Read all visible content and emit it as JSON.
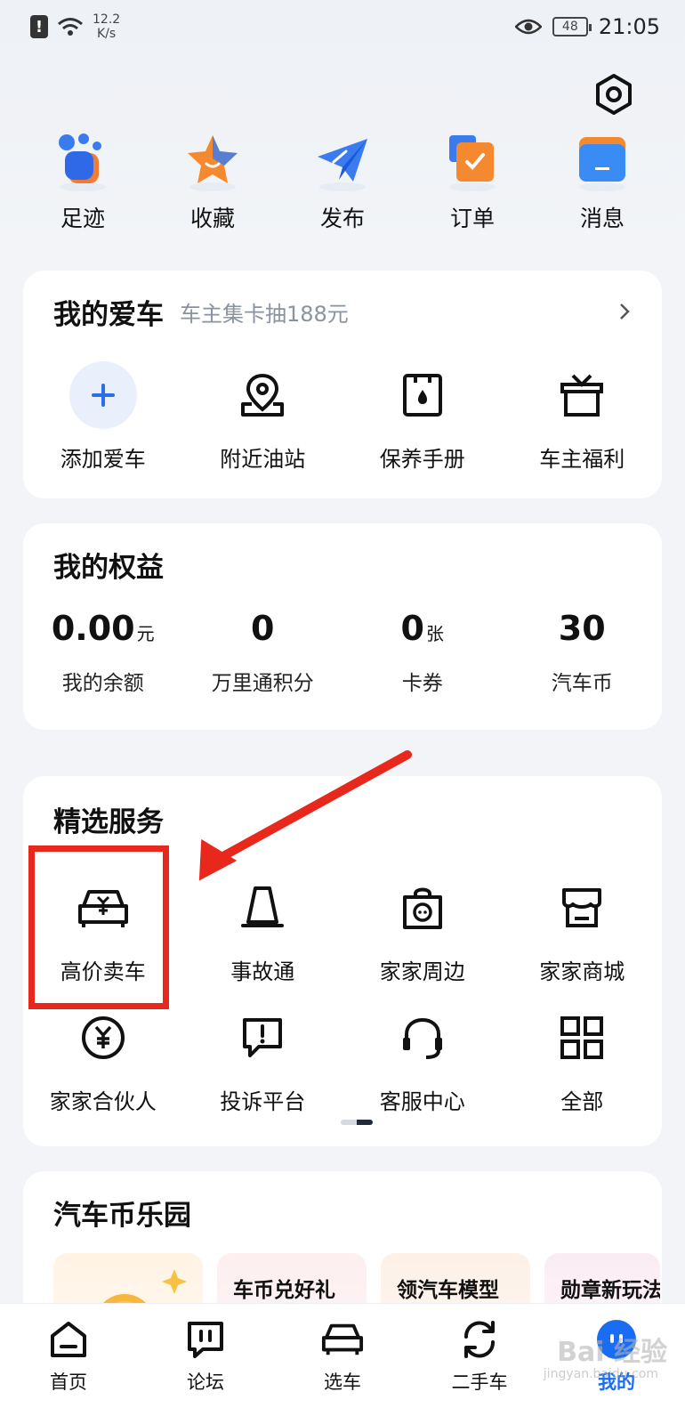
{
  "status_bar": {
    "speed_value": "12.2",
    "speed_unit": "K/s",
    "battery": "48",
    "time": "21:05"
  },
  "quick_links": [
    {
      "label": "足迹",
      "icon": "footprint-icon"
    },
    {
      "label": "收藏",
      "icon": "star-icon"
    },
    {
      "label": "发布",
      "icon": "paper-plane-icon"
    },
    {
      "label": "订单",
      "icon": "order-icon"
    },
    {
      "label": "消息",
      "icon": "message-icon"
    }
  ],
  "my_car": {
    "title": "我的爱车",
    "subtitle": "车主集卡抽188元",
    "items": [
      {
        "label": "添加爱车",
        "icon": "plus-icon"
      },
      {
        "label": "附近油站",
        "icon": "location-pin-icon"
      },
      {
        "label": "保养手册",
        "icon": "maintenance-book-icon"
      },
      {
        "label": "车主福利",
        "icon": "gift-box-icon"
      }
    ]
  },
  "my_rights": {
    "title": "我的权益",
    "items": [
      {
        "value": "0.00",
        "unit": "元",
        "label": "我的余额"
      },
      {
        "value": "0",
        "unit": "",
        "label": "万里通积分"
      },
      {
        "value": "0",
        "unit": "张",
        "label": "卡券"
      },
      {
        "value": "30",
        "unit": "",
        "label": "汽车币"
      }
    ]
  },
  "services": {
    "title": "精选服务",
    "row1": [
      {
        "label": "高价卖车",
        "icon": "sell-car-yuan-icon"
      },
      {
        "label": "事故通",
        "icon": "traffic-cone-icon"
      },
      {
        "label": "家家周边",
        "icon": "shopping-bag-icon"
      },
      {
        "label": "家家商城",
        "icon": "storefront-icon"
      }
    ],
    "row2": [
      {
        "label": "家家合伙人",
        "icon": "yuan-coin-icon"
      },
      {
        "label": "投诉平台",
        "icon": "complaint-icon"
      },
      {
        "label": "客服中心",
        "icon": "headset-icon"
      },
      {
        "label": "全部",
        "icon": "grid-icon"
      }
    ]
  },
  "coin_park": {
    "title": "汽车币乐园",
    "tiles": [
      "",
      "车币兑好礼",
      "领汽车模型",
      "勋章新玩法"
    ]
  },
  "bottom_nav": [
    {
      "label": "首页",
      "icon": "home-icon"
    },
    {
      "label": "论坛",
      "icon": "forum-icon"
    },
    {
      "label": "选车",
      "icon": "car-select-icon"
    },
    {
      "label": "二手车",
      "icon": "used-car-icon"
    },
    {
      "label": "我的",
      "icon": "mine-icon",
      "active": true
    }
  ],
  "watermark": {
    "text": "Bai 经验",
    "sub": "jingyan.baidu.com"
  },
  "colors": {
    "accent": "#1a6df2",
    "highlight": "#e8281c",
    "text": "#111111",
    "muted": "#8a93a0"
  }
}
